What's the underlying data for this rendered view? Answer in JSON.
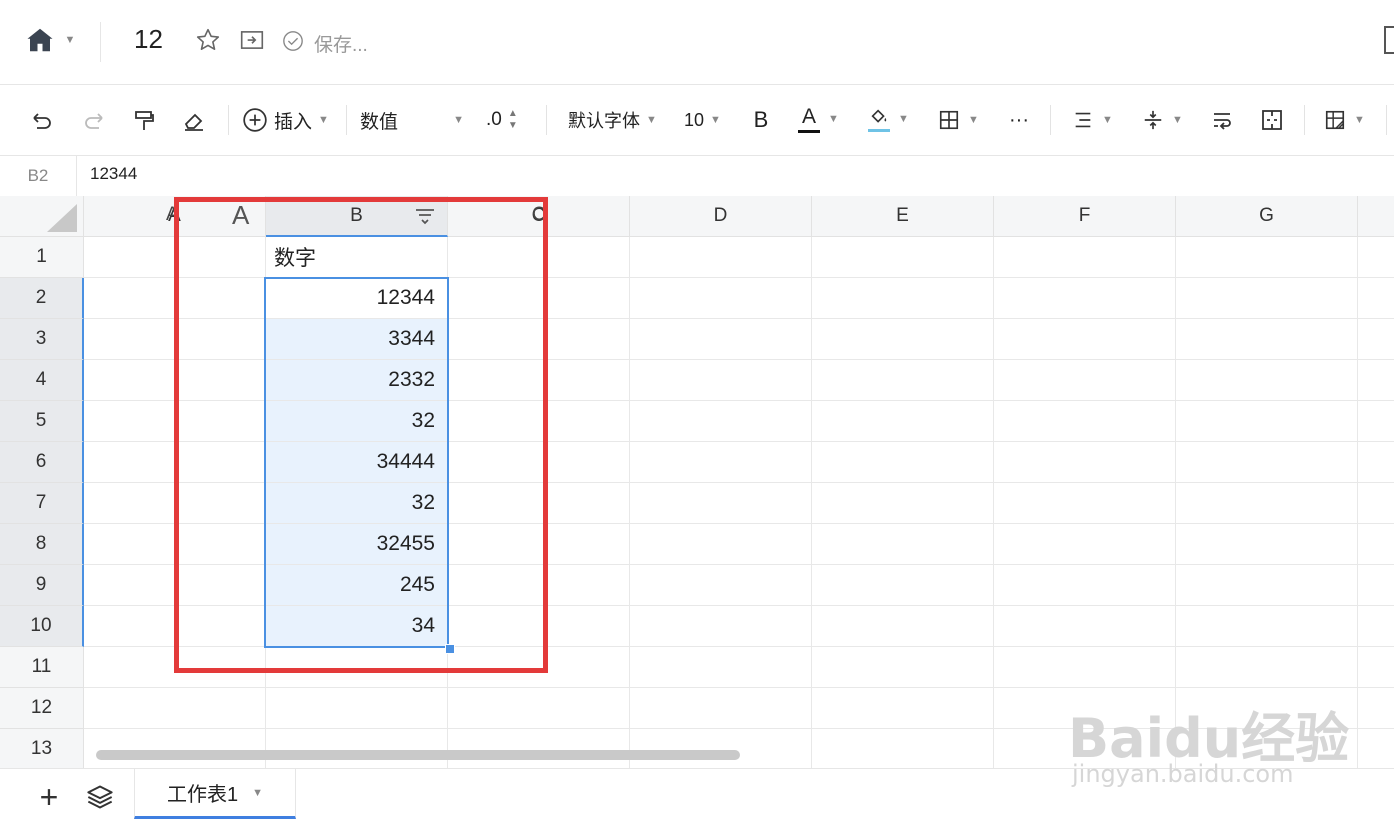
{
  "header": {
    "doc_title": "12",
    "save_status": "保存...",
    "home_icon": "home-icon",
    "star_icon": "star-icon",
    "move_icon": "move-to-folder-icon",
    "check_icon": "check-circle-icon"
  },
  "toolbar": {
    "insert_label": "插入",
    "number_format": "数值",
    "decimal_label": ".0",
    "font_name": "默认字体",
    "font_size": "10",
    "bold_label": "B",
    "text_color_label": "A",
    "more_label": "···"
  },
  "formula_bar": {
    "cell_ref": "B2",
    "value": "12344"
  },
  "grid": {
    "columns": [
      "A",
      "B",
      "C",
      "D",
      "E",
      "F",
      "G"
    ],
    "rows": [
      "1",
      "2",
      "3",
      "4",
      "5",
      "6",
      "7",
      "8",
      "9",
      "10",
      "11",
      "12",
      "13"
    ],
    "header_cell": "数字",
    "values": [
      "12344",
      "3344",
      "2332",
      "32",
      "34444",
      "32",
      "32455",
      "245",
      "34"
    ],
    "overlay_ghost_label": "A",
    "ghost_label_A": "A",
    "ghost_label_C": "C"
  },
  "sheets": {
    "tabs": [
      "工作表1"
    ],
    "add_label": "+"
  },
  "watermark": {
    "brand": "Baidu经验",
    "url": "jingyan.baidu.com"
  },
  "colors": {
    "accent_blue": "#4a90e2",
    "highlight_red": "#e33a3a",
    "selection_fill": "#e8f2fd"
  }
}
